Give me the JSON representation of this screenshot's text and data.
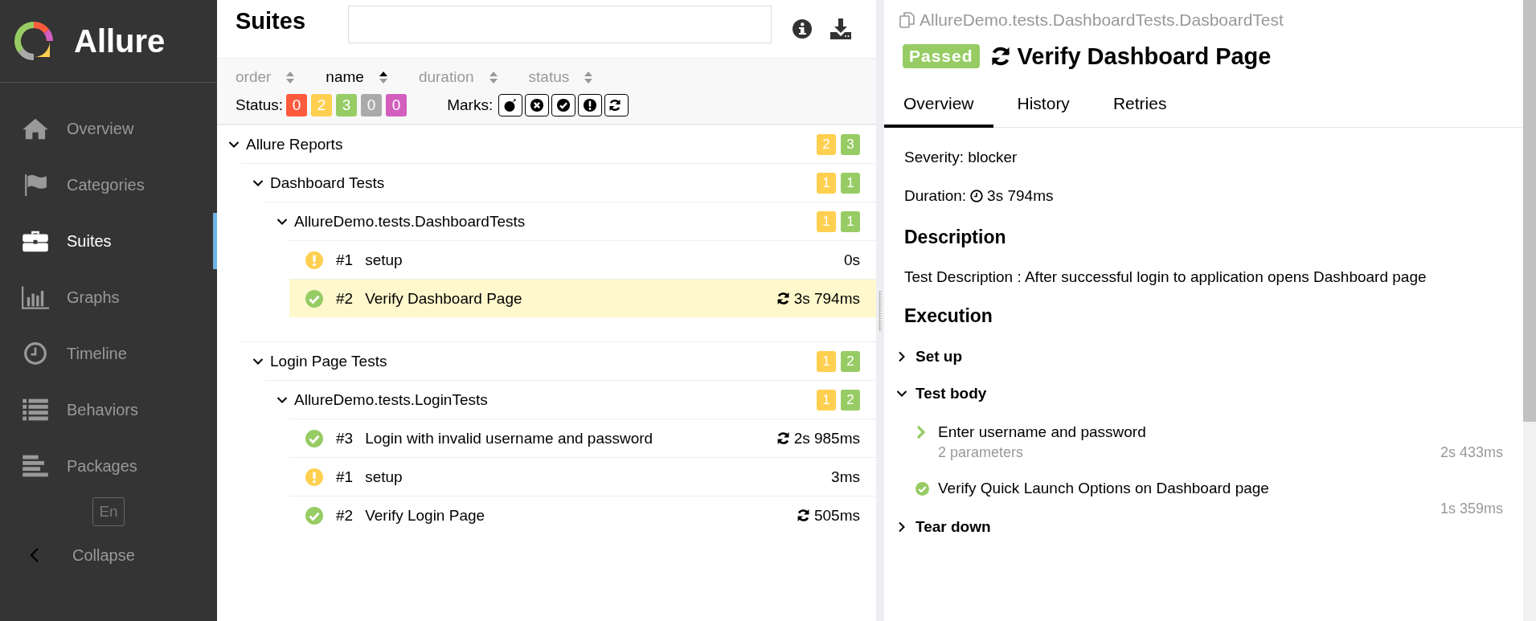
{
  "sidebar": {
    "logo": "Allure",
    "items": [
      {
        "kind": "home",
        "label": "Overview",
        "selected": false
      },
      {
        "kind": "flag",
        "label": "Categories",
        "selected": false
      },
      {
        "kind": "briefcase",
        "label": "Suites",
        "selected": true
      },
      {
        "kind": "chart",
        "label": "Graphs",
        "selected": false
      },
      {
        "kind": "clock",
        "label": "Timeline",
        "selected": false
      },
      {
        "kind": "list",
        "label": "Behaviors",
        "selected": false
      },
      {
        "kind": "bars",
        "label": "Packages",
        "selected": false
      }
    ],
    "language": "En",
    "collapse": "Collapse"
  },
  "suites": {
    "title": "Suites",
    "sort": [
      {
        "label": "order",
        "selected": false
      },
      {
        "label": "name",
        "selected": true
      },
      {
        "label": "duration",
        "selected": false
      },
      {
        "label": "status",
        "selected": false
      }
    ],
    "status_filter": {
      "label": "Status:",
      "items": [
        {
          "value": "0",
          "color": "#fd5a3e"
        },
        {
          "value": "2",
          "color": "#ffd050"
        },
        {
          "value": "3",
          "color": "#97cc64"
        },
        {
          "value": "0",
          "color": "#aaaaaa"
        },
        {
          "value": "0",
          "color": "#d35ebe"
        }
      ]
    },
    "marks": {
      "label": "Marks:",
      "items": [
        {
          "kind": "flaky"
        },
        {
          "kind": "new_failed"
        },
        {
          "kind": "new_passed"
        },
        {
          "kind": "new_broken"
        },
        {
          "kind": "retries"
        }
      ]
    },
    "tree": [
      {
        "kind": "group",
        "name": "Allure Reports",
        "expanded": true,
        "counts": [
          {
            "value": "2",
            "color": "#ffd050"
          },
          {
            "value": "3",
            "color": "#97cc64"
          }
        ],
        "children": [
          {
            "kind": "group",
            "name": "Dashboard Tests",
            "expanded": true,
            "counts": [
              {
                "value": "1",
                "color": "#ffd050"
              },
              {
                "value": "1",
                "color": "#97cc64"
              }
            ],
            "children": [
              {
                "kind": "group",
                "name": "AllureDemo.tests.DashboardTests",
                "expanded": true,
                "counts": [
                  {
                    "value": "1",
                    "color": "#ffd050"
                  },
                  {
                    "value": "1",
                    "color": "#97cc64"
                  }
                ],
                "children": [
                  {
                    "kind": "broken",
                    "order": "#1",
                    "name": "setup",
                    "retried": false,
                    "duration": "0s",
                    "selected": false
                  },
                  {
                    "kind": "passed",
                    "order": "#2",
                    "name": "Verify Dashboard Page",
                    "retried": true,
                    "duration": "3s 794ms",
                    "selected": true
                  }
                ]
              }
            ]
          },
          {
            "kind": "group",
            "name": "Login Page Tests",
            "expanded": true,
            "counts": [
              {
                "value": "1",
                "color": "#ffd050"
              },
              {
                "value": "2",
                "color": "#97cc64"
              }
            ],
            "children": [
              {
                "kind": "group",
                "name": "AllureDemo.tests.LoginTests",
                "expanded": true,
                "counts": [
                  {
                    "value": "1",
                    "color": "#ffd050"
                  },
                  {
                    "value": "2",
                    "color": "#97cc64"
                  }
                ],
                "children": [
                  {
                    "kind": "passed",
                    "order": "#3",
                    "name": "Login with invalid username and password",
                    "retried": true,
                    "duration": "2s 985ms",
                    "selected": false
                  },
                  {
                    "kind": "broken",
                    "order": "#1",
                    "name": "setup",
                    "retried": false,
                    "duration": "3ms",
                    "selected": false
                  },
                  {
                    "kind": "passed",
                    "order": "#2",
                    "name": "Verify Login Page",
                    "retried": true,
                    "duration": "505ms",
                    "selected": false
                  }
                ]
              }
            ]
          }
        ]
      }
    ]
  },
  "detail": {
    "path": "AllureDemo.tests.DashboardTests.DasboardTest",
    "status": {
      "kind": "passed",
      "label": "Passed"
    },
    "retried": true,
    "title": "Verify Dashboard Page",
    "tabs": [
      {
        "label": "Overview",
        "selected": true
      },
      {
        "label": "History",
        "selected": false
      },
      {
        "label": "Retries",
        "selected": false
      }
    ],
    "severity": "Severity: blocker",
    "duration_label": "Duration:",
    "duration": "3s 794ms",
    "description_heading": "Description",
    "description": "Test Description : After successful login to application opens Dashboard page",
    "execution_heading": "Execution",
    "stages": [
      {
        "title": "Set up",
        "expanded": false
      },
      {
        "title": "Test body",
        "expanded": true,
        "steps": [
          {
            "kind": "expandable",
            "name": "Enter username and password",
            "parameters": "2 parameters",
            "duration": "2s 433ms"
          },
          {
            "kind": "passed",
            "name": "Verify Quick Launch Options on Dashboard page",
            "duration": "1s 359ms"
          }
        ]
      },
      {
        "title": "Tear down",
        "expanded": false
      }
    ]
  }
}
